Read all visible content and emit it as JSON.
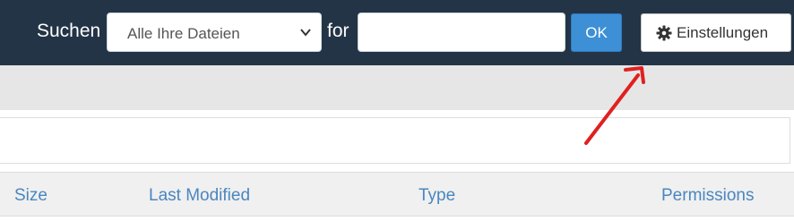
{
  "toolbar": {
    "search_label": "Suchen",
    "scope_value": "Alle Ihre Dateien",
    "for_label": "for",
    "search_value": "",
    "search_placeholder": "",
    "ok_label": "OK",
    "settings_label": "Einstellungen",
    "settings_icon": "gear-icon",
    "scope_chevron_icon": "chevron-down-icon"
  },
  "table": {
    "columns": [
      "Size",
      "Last Modified",
      "Type",
      "Permissions"
    ]
  },
  "colors": {
    "topbar": "#243447",
    "ok_button": "#3d8fd6",
    "column_link": "#4a86c0",
    "annotation_arrow": "#e02020"
  }
}
